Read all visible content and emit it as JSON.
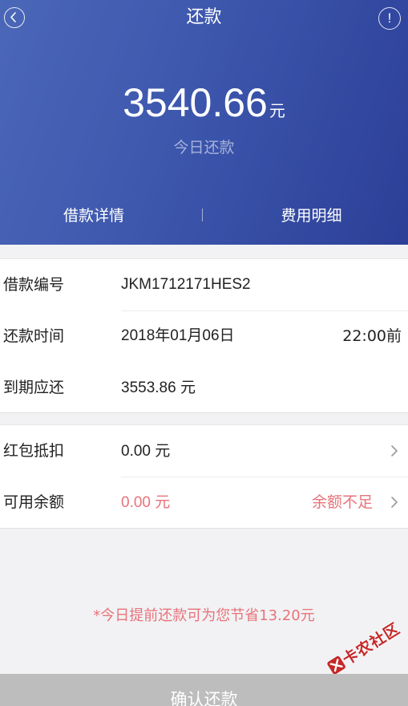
{
  "header": {
    "title": "还款",
    "info_glyph": "!",
    "back_icon": "chevron-left-icon",
    "amount": "3540.66",
    "amount_unit": "元",
    "amount_label": "今日还款",
    "tabs": [
      {
        "label": "借款详情"
      },
      {
        "label": "费用明细"
      }
    ]
  },
  "loan_info": {
    "rows": [
      {
        "label": "借款编号",
        "value": "JKM1712171HES2"
      },
      {
        "label": "还款时间",
        "value": "2018年01月06日",
        "extra": "22:00前"
      },
      {
        "label": "到期应还",
        "value": "3553.86",
        "unit": "元"
      }
    ]
  },
  "deductions": {
    "rows": [
      {
        "label": "红包抵扣",
        "value": "0.00",
        "unit": "元"
      },
      {
        "label": "可用余额",
        "value": "0.00",
        "unit": "元",
        "note": "余额不足"
      }
    ]
  },
  "savings_note": "*今日提前还款可为您节省13.20元",
  "confirm_label": "确认还款",
  "watermark": {
    "text": "卡农社区"
  },
  "colors": {
    "header_start": "#4b67b8",
    "header_end": "#2c3f98",
    "warning": "#e8737a",
    "button_disabled": "#bdbdbd"
  }
}
